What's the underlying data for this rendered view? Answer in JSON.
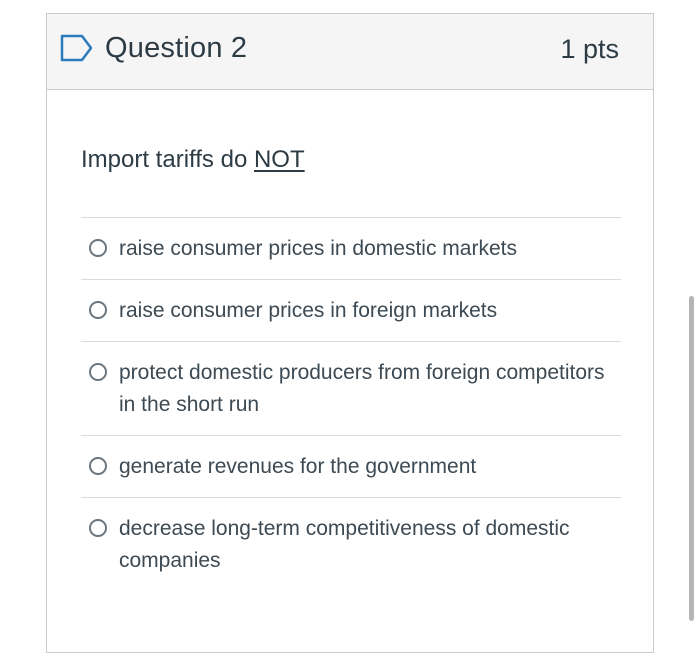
{
  "question": {
    "title": "Question 2",
    "points": "1 pts",
    "prompt_text": "Import tariffs do ",
    "prompt_emphasis": "NOT"
  },
  "answers": [
    {
      "label": "raise consumer prices in domestic markets"
    },
    {
      "label": "raise consumer prices in foreign markets"
    },
    {
      "label": "protect domestic producers from foreign competitors in the short run"
    },
    {
      "label": "generate revenues for the government"
    },
    {
      "label": "decrease long-term competitiveness of domestic companies"
    }
  ],
  "icons": {
    "flag": "flag-icon",
    "radio": "radio-button-icon"
  },
  "colors": {
    "header_bg": "#f5f5f5",
    "border": "#c7cdd1",
    "text": "#2d3b45"
  }
}
